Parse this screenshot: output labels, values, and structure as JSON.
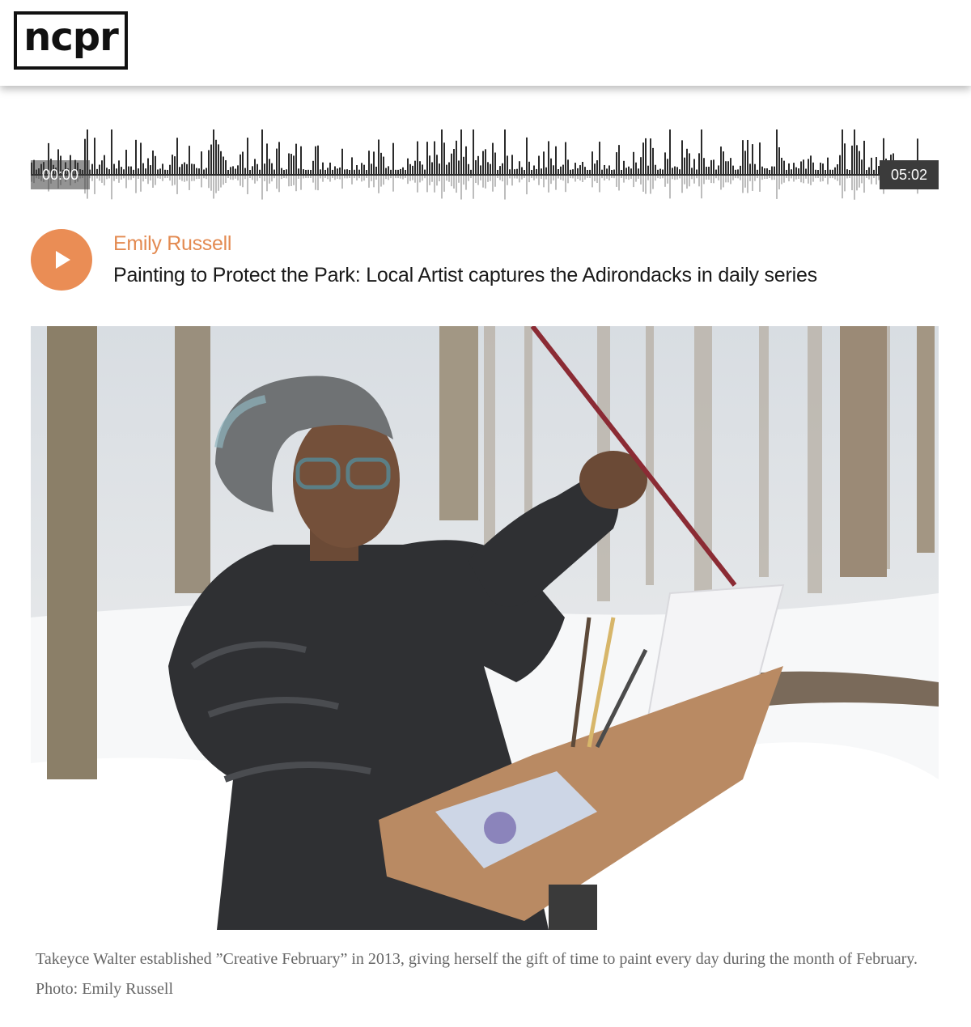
{
  "header": {
    "logo_text": "ncpr"
  },
  "player": {
    "current_time": "00:00",
    "duration": "05:02",
    "progress": 0.0,
    "play_icon": "play-icon",
    "accent_color": "#ea8d55"
  },
  "episode": {
    "author": "Emily Russell",
    "title": "Painting to Protect the Park: Local Artist captures the Adirondacks in daily series"
  },
  "photo": {
    "subject": "photo-of-artist-painting-outdoors-in-snowy-forest"
  },
  "caption": {
    "text": "Takeyce Walter established ”Creative February” in 2013, giving herself the gift of time to paint every day during the month of February. Photo: Emily Russell"
  },
  "colors": {
    "author": "#e38a51",
    "waveform": "#2b2b2b",
    "caption": "#666666"
  }
}
